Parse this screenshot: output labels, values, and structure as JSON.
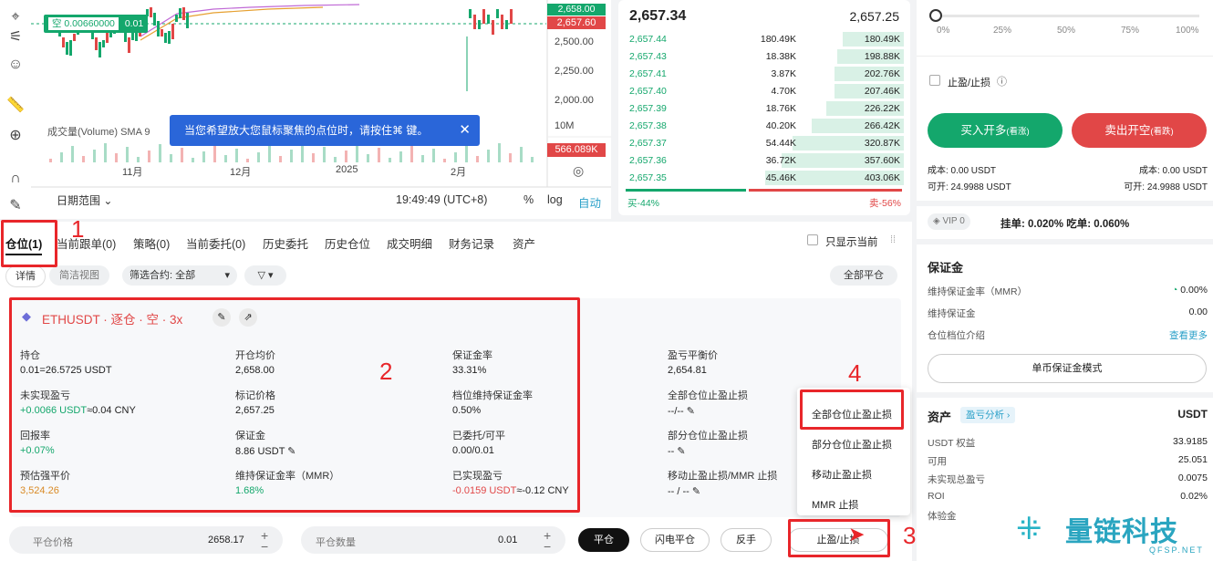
{
  "chart": {
    "overlay_label": "空 0.00660000",
    "overlay_value": "0.01",
    "price_tags": [
      "2,658.00",
      "2,657.60"
    ],
    "y_ticks": [
      "2,500.00",
      "2,250.00",
      "2,000.00"
    ],
    "volume_label": "成交量(Volume) SMA 9",
    "volume_tick": "10M",
    "volume_tag": "566.089K",
    "x_ticks": [
      "11月",
      "12月",
      "2025",
      "2月"
    ],
    "date_range": "日期范围",
    "clock": "19:49:49 (UTC+8)",
    "pct": "%",
    "log": "log",
    "auto": "自动",
    "tooltip": "当您希望放大您鼠标聚焦的点位时，请按住⌘ 键。"
  },
  "orderbook": {
    "last_price": "2,657.34",
    "mark_price": "2,657.25",
    "rows": [
      {
        "price": "2,657.44",
        "qty": "180.49K",
        "total": "180.49K",
        "depth": 0.22
      },
      {
        "price": "2,657.43",
        "qty": "18.38K",
        "total": "198.88K",
        "depth": 0.24
      },
      {
        "price": "2,657.41",
        "qty": "3.87K",
        "total": "202.76K",
        "depth": 0.25
      },
      {
        "price": "2,657.40",
        "qty": "4.70K",
        "total": "207.46K",
        "depth": 0.25
      },
      {
        "price": "2,657.39",
        "qty": "18.76K",
        "total": "226.22K",
        "depth": 0.28
      },
      {
        "price": "2,657.38",
        "qty": "40.20K",
        "total": "266.42K",
        "depth": 0.33
      },
      {
        "price": "2,657.37",
        "qty": "54.44K",
        "total": "320.87K",
        "depth": 0.4
      },
      {
        "price": "2,657.36",
        "qty": "36.72K",
        "total": "357.60K",
        "depth": 0.44
      },
      {
        "price": "2,657.35",
        "qty": "45.46K",
        "total": "403.06K",
        "depth": 0.5
      }
    ],
    "buy_ratio": "买-44%",
    "sell_ratio": "卖-56%"
  },
  "tabs": [
    "仓位(1)",
    "当前跟单(0)",
    "策略(0)",
    "当前委托(0)",
    "历史委托",
    "历史仓位",
    "成交明细",
    "财务记录",
    "资产"
  ],
  "show_current_only": "只显示当前",
  "subtabs": {
    "detail": "详情",
    "simple": "简洁视图",
    "filter_label": "筛选合约: 全部",
    "close_all": "全部平仓"
  },
  "position": {
    "title": "ETHUSDT · 逐仓 · 空 · 3x",
    "fields": [
      {
        "label": "持仓",
        "value": "0.01=26.5725 USDT",
        "color": "normal"
      },
      {
        "label": "开仓均价",
        "value": "2,658.00",
        "color": "normal"
      },
      {
        "label": "保证金率",
        "value": "33.31%",
        "color": "normal"
      },
      {
        "label": "盈亏平衡价",
        "value": "2,654.81",
        "color": "normal"
      },
      {
        "label": "未实现盈亏",
        "value": "+0.0066 USDT",
        "value2": "≈0.04 CNY",
        "color": "green"
      },
      {
        "label": "标记价格",
        "value": "2,657.25",
        "color": "normal"
      },
      {
        "label": "档位维持保证金率",
        "value": "0.50%",
        "color": "normal"
      },
      {
        "label": "全部仓位止盈止损",
        "value": "--/--",
        "color": "normal"
      },
      {
        "label": "回报率",
        "value": "+0.07%",
        "color": "green"
      },
      {
        "label": "保证金",
        "value": "8.86 USDT",
        "color": "normal"
      },
      {
        "label": "已委托/可平",
        "value": "0.00/0.01",
        "color": "normal"
      },
      {
        "label": "部分仓位止盈止损",
        "value": "--",
        "color": "normal"
      },
      {
        "label": "预估强平价",
        "value": "3,524.26",
        "color": "orange"
      },
      {
        "label": "维持保证金率（MMR）",
        "value": "1.68%",
        "color": "green"
      },
      {
        "label": "已实现盈亏",
        "value": "-0.0159 USDT",
        "value2": "≈-0.12 CNY",
        "color": "red"
      },
      {
        "label": "移动止盈止损/MMR 止损",
        "value": "-- / --",
        "color": "normal"
      }
    ]
  },
  "tp_menu": [
    "全部仓位止盈止损",
    "部分仓位止盈止损",
    "移动止盈止损",
    "MMR 止损"
  ],
  "bottom_bar": {
    "close_price_label": "平仓价格",
    "close_price_value": "2658.17",
    "close_qty_label": "平仓数量",
    "close_qty_value": "0.01",
    "close_btn": "平仓",
    "flash_btn": "闪电平仓",
    "reverse_btn": "反手",
    "tpsl_btn": "止盈/止损"
  },
  "annotations": [
    "1",
    "2",
    "3",
    "4"
  ],
  "right": {
    "slider_marks": [
      "0%",
      "25%",
      "50%",
      "75%",
      "100%"
    ],
    "slider_value": 0,
    "tpsl_label": "止盈/止损",
    "buy_btn": "买入开多",
    "buy_tag": "(看涨)",
    "sell_btn": "卖出开空",
    "sell_tag": "(看跌)",
    "cost_left": "成本: 0.00 USDT",
    "cost_right": "成本: 0.00 USDT",
    "avail_left": "可开: 24.9988 USDT",
    "avail_right": "可开: 24.9988 USDT",
    "vip": "VIP 0",
    "fees": "挂单: 0.020%  吃单: 0.060%",
    "margin_title": "保证金",
    "mmr_label": "维持保证金率（MMR）",
    "mmr_value": "0.00%",
    "maint_label": "维持保证金",
    "maint_value": "0.00",
    "tier_label": "仓位档位介绍",
    "view_more": "查看更多",
    "single_mode": "单币保证金模式",
    "assets_title": "资产",
    "pnl_analysis": "盈亏分析",
    "currency": "USDT",
    "assets": [
      {
        "label": "USDT 权益",
        "value": "33.9185"
      },
      {
        "label": "可用",
        "value": "25.051"
      },
      {
        "label": "未实现总盈亏",
        "value": "0.0075"
      },
      {
        "label": "ROI",
        "value": "0.02%"
      },
      {
        "label": "体验金",
        "value": ""
      }
    ]
  },
  "watermark": {
    "brand": "量链科技",
    "site": "QFSP.NET"
  }
}
